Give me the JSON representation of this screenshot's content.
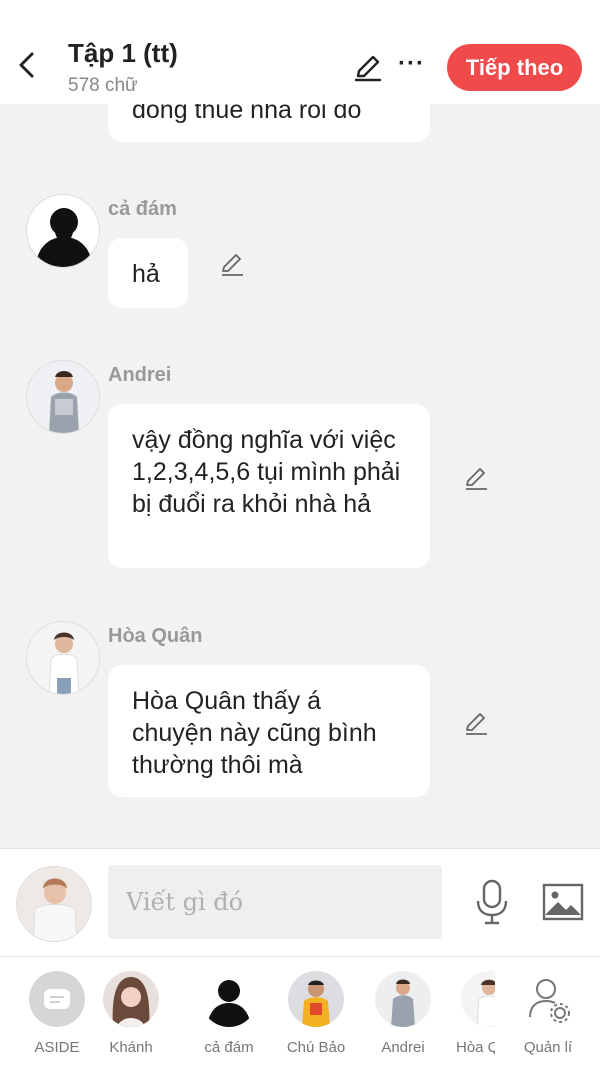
{
  "header": {
    "title": "Tập 1 (tt)",
    "word_count": "578 chữ",
    "next_label": "Tiếp theo",
    "more_label": "···",
    "accent": "#f04a4a"
  },
  "messages": [
    {
      "sender": "",
      "text": "đóng thuế nhà rồi đó",
      "icon": ""
    },
    {
      "sender": "cả đám",
      "text": "hả",
      "icon": "silhouette"
    },
    {
      "sender": "Andrei",
      "text": "vậy đồng nghĩa với việc 1,2,3,4,5,6 tụi mình phải bị đuổi ra khỏi nhà hả",
      "icon": "person"
    },
    {
      "sender": "Hòa Quân",
      "text": "Hòa Quân thấy á chuyện này cũng bình thường thôi mà",
      "icon": "person"
    }
  ],
  "composer": {
    "placeholder": "Viết gì đó"
  },
  "characters": [
    {
      "label": "ASIDE"
    },
    {
      "label": "Khánh"
    },
    {
      "label": "cả đám"
    },
    {
      "label": "Chú Bảo"
    },
    {
      "label": "Andrei"
    },
    {
      "label": "Hòa Q"
    },
    {
      "label": "Quản lí"
    }
  ]
}
